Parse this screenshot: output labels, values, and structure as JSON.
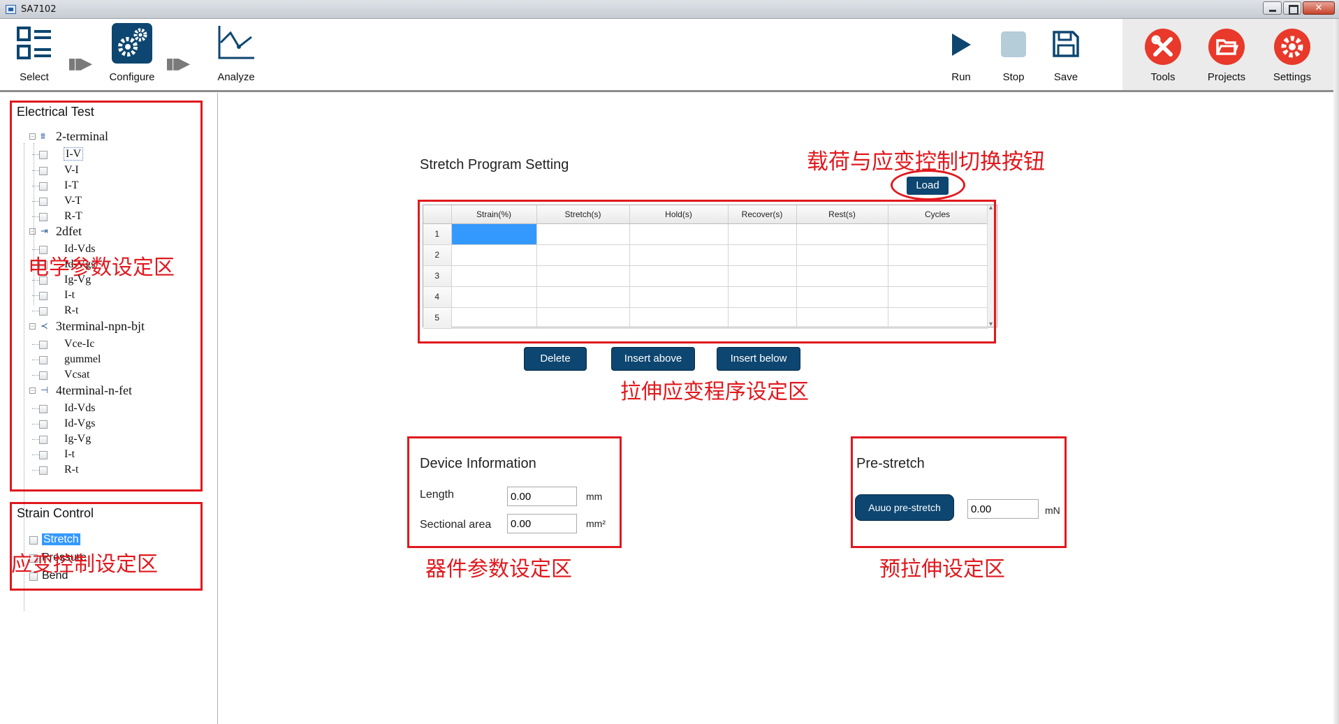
{
  "window": {
    "title": "SA7102"
  },
  "toolbar": {
    "select": "Select",
    "configure": "Configure",
    "analyze": "Analyze",
    "run": "Run",
    "stop": "Stop",
    "save": "Save",
    "tools": "Tools",
    "projects": "Projects",
    "settings": "Settings",
    "accent": "#0d4670",
    "tool_color": "#e8392a"
  },
  "sidebar": {
    "electrical_title": "Electrical Test",
    "groups": [
      {
        "label": "2-terminal",
        "items": [
          "I-V",
          "V-I",
          "I-T",
          "V-T",
          "R-T"
        ]
      },
      {
        "label": "2dfet",
        "items": [
          "Id-Vds",
          "Id-Vgs",
          "Ig-Vg",
          "I-t",
          "R-t"
        ]
      },
      {
        "label": "3terminal-npn-bjt",
        "items": [
          "Vce-Ic",
          "gummel",
          "Vcsat"
        ]
      },
      {
        "label": "4terminal-n-fet",
        "items": [
          "Id-Vds",
          "Id-Vgs",
          "Ig-Vg",
          "I-t",
          "R-t"
        ]
      }
    ],
    "strain_title": "Strain Control",
    "strain_items": [
      "Stretch",
      "Pressure",
      "Bend"
    ]
  },
  "annotations": {
    "electrical_zone": "电学参数设定区",
    "strain_zone": "应变控制设定区",
    "load_toggle": "载荷与应变控制切换按钮",
    "program_zone": "拉伸应变程序设定区",
    "device_zone": "器件参数设定区",
    "prestretch_zone": "预拉伸设定区"
  },
  "program": {
    "title": "Stretch Program Setting",
    "load_button": "Load",
    "columns": [
      "Strain(%)",
      "Stretch(s)",
      "Hold(s)",
      "Recover(s)",
      "Rest(s)",
      "Cycles"
    ],
    "rows": [
      "1",
      "2",
      "3",
      "4",
      "5"
    ],
    "delete_button": "Delete",
    "insert_above_button": "Insert above",
    "insert_below_button": "Insert below"
  },
  "device": {
    "title": "Device Information",
    "length_label": "Length",
    "length_value": "0.00",
    "length_unit": "mm",
    "area_label": "Sectional area",
    "area_value": "0.00",
    "area_unit": "mm²"
  },
  "prestretch": {
    "title": "Pre-stretch",
    "button": "Auuo pre-stretch",
    "value": "0.00",
    "unit": "mN"
  }
}
